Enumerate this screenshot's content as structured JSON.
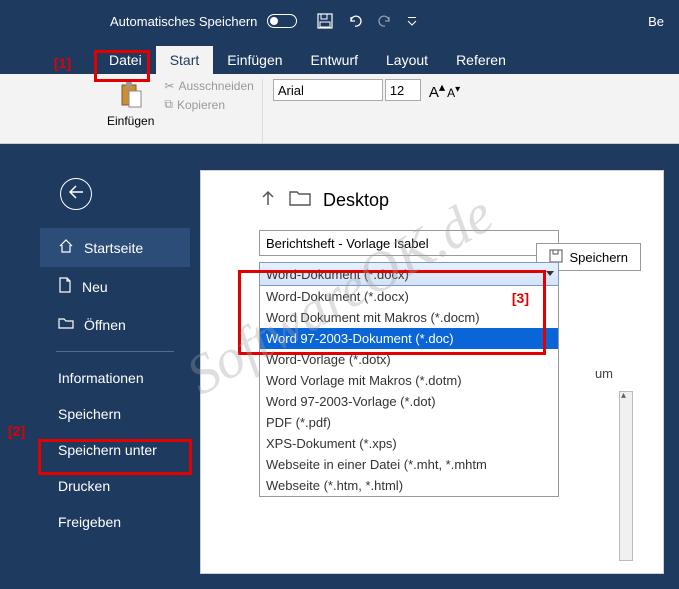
{
  "titlebar": {
    "autosave_label": "Automatisches Speichern",
    "right_text": "Be"
  },
  "ribbon": {
    "tabs": [
      "Datei",
      "Start",
      "Einfügen",
      "Entwurf",
      "Layout",
      "Referen"
    ],
    "paste_label": "Einfügen",
    "cut_label": "Ausschneiden",
    "copy_label": "Kopieren",
    "font_name": "Arial",
    "font_size": "12"
  },
  "backstage": {
    "items": {
      "home": "Startseite",
      "new": "Neu",
      "open": "Öffnen",
      "info": "Informationen",
      "save": "Speichern",
      "saveas": "Speichern unter",
      "print": "Drucken",
      "share": "Freigeben"
    }
  },
  "save_panel": {
    "location": "Desktop",
    "filename": "Berichtsheft - Vorlage Isabel",
    "save_button": "Speichern",
    "filetype_selected": "Word-Dokument (*.docx)",
    "filetype_options": [
      "Word-Dokument (*.docx)",
      "Word Dokument mit Makros (*.docm)",
      "Word 97-2003-Dokument (*.doc)",
      "Word-Vorlage (*.dotx)",
      "Word Vorlage mit Makros (*.dotm)",
      "Word 97-2003-Vorlage (*.dot)",
      "PDF (*.pdf)",
      "XPS-Dokument (*.xps)",
      "Webseite in einer Datei (*.mht, *.mhtm",
      "Webseite (*.htm, *.html)"
    ],
    "highlighted_index": 2,
    "extra_text": "um"
  },
  "annotations": {
    "one": "[1]",
    "two": "[2]",
    "three": "[3]"
  },
  "watermark": "SoftwareOK.de"
}
